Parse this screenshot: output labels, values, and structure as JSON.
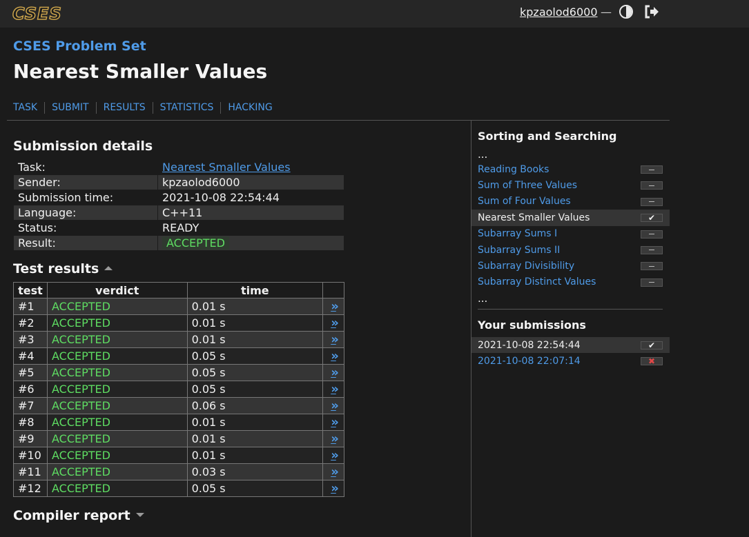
{
  "header": {
    "logo": "CSES",
    "username": "kpzaolod6000",
    "dash": "—",
    "icons": [
      "theme-toggle-icon",
      "logout-icon"
    ]
  },
  "page": {
    "suptitle": "CSES Problem Set",
    "title": "Nearest Smaller Values"
  },
  "nav": [
    "TASK",
    "SUBMIT",
    "RESULTS",
    "STATISTICS",
    "HACKING"
  ],
  "details": {
    "heading": "Submission details",
    "rows": [
      {
        "label": "Task:",
        "value": "Nearest Smaller Values"
      },
      {
        "label": "Sender:",
        "value": "kpzaolod6000"
      },
      {
        "label": "Submission time:",
        "value": "2021-10-08 22:54:44"
      },
      {
        "label": "Language:",
        "value": "C++11"
      },
      {
        "label": "Status:",
        "value": "READY"
      },
      {
        "label": "Result:",
        "value": "ACCEPTED"
      }
    ]
  },
  "tests": {
    "heading": "Test results",
    "columns": [
      "test",
      "verdict",
      "time"
    ],
    "rows": [
      {
        "test": "#1",
        "verdict": "ACCEPTED",
        "time": "0.01 s"
      },
      {
        "test": "#2",
        "verdict": "ACCEPTED",
        "time": "0.01 s"
      },
      {
        "test": "#3",
        "verdict": "ACCEPTED",
        "time": "0.01 s"
      },
      {
        "test": "#4",
        "verdict": "ACCEPTED",
        "time": "0.05 s"
      },
      {
        "test": "#5",
        "verdict": "ACCEPTED",
        "time": "0.05 s"
      },
      {
        "test": "#6",
        "verdict": "ACCEPTED",
        "time": "0.05 s"
      },
      {
        "test": "#7",
        "verdict": "ACCEPTED",
        "time": "0.06 s"
      },
      {
        "test": "#8",
        "verdict": "ACCEPTED",
        "time": "0.01 s"
      },
      {
        "test": "#9",
        "verdict": "ACCEPTED",
        "time": "0.01 s"
      },
      {
        "test": "#10",
        "verdict": "ACCEPTED",
        "time": "0.01 s"
      },
      {
        "test": "#11",
        "verdict": "ACCEPTED",
        "time": "0.03 s"
      },
      {
        "test": "#12",
        "verdict": "ACCEPTED",
        "time": "0.05 s"
      }
    ],
    "link_glyph": "»"
  },
  "compiler": {
    "heading": "Compiler report"
  },
  "sidebar": {
    "section_title": "Sorting and Searching",
    "ellipsis": "...",
    "problems": [
      {
        "name": "Reading Books",
        "status": "none",
        "active": false
      },
      {
        "name": "Sum of Three Values",
        "status": "none",
        "active": false
      },
      {
        "name": "Sum of Four Values",
        "status": "none",
        "active": false
      },
      {
        "name": "Nearest Smaller Values",
        "status": "ok",
        "active": true
      },
      {
        "name": "Subarray Sums I",
        "status": "none",
        "active": false
      },
      {
        "name": "Subarray Sums II",
        "status": "none",
        "active": false
      },
      {
        "name": "Subarray Divisibility",
        "status": "none",
        "active": false
      },
      {
        "name": "Subarray Distinct Values",
        "status": "none",
        "active": false
      }
    ],
    "submissions_title": "Your submissions",
    "submissions": [
      {
        "time": "2021-10-08 22:54:44",
        "status": "ok",
        "active": true
      },
      {
        "time": "2021-10-08 22:07:14",
        "status": "bad",
        "active": false
      }
    ]
  },
  "colors": {
    "background": "#1b1b1b",
    "link": "#4f9be8",
    "accepted": "#5edc62",
    "rejected": "#e04848",
    "logo": "#c9a24b"
  }
}
